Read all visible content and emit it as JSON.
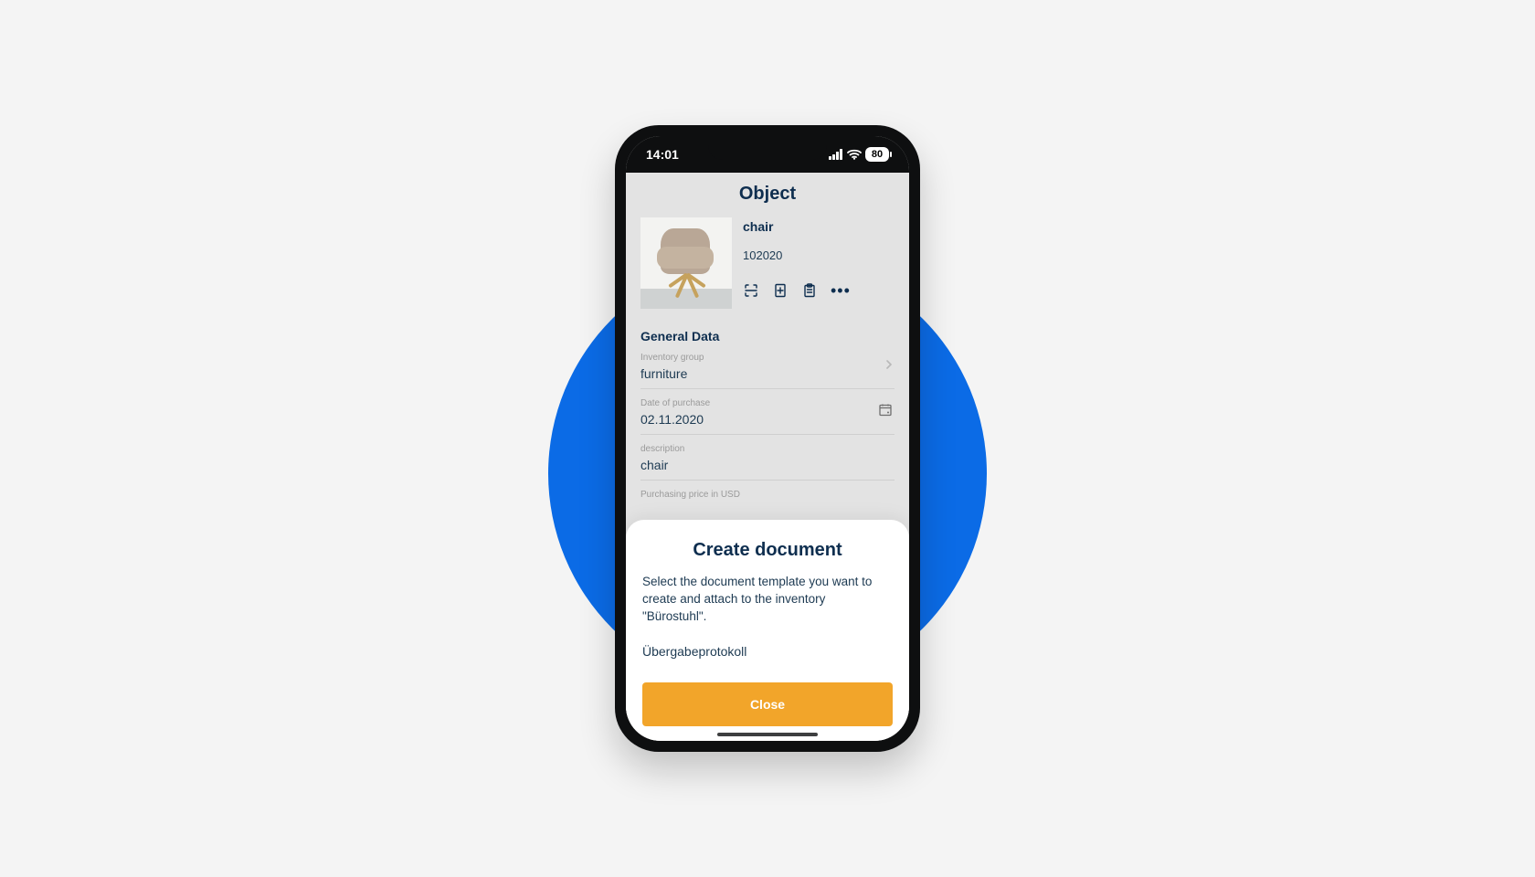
{
  "statusbar": {
    "time": "14:01",
    "battery": "80"
  },
  "page": {
    "title": "Object",
    "object_name": "chair",
    "object_code": "102020",
    "section_title": "General Data",
    "fields": {
      "inventory_group_label": "Inventory group",
      "inventory_group_value": "furniture",
      "purchase_date_label": "Date of purchase",
      "purchase_date_value": "02.11.2020",
      "description_label": "description",
      "description_value": "chair",
      "price_label": "Purchasing price in USD"
    }
  },
  "sheet": {
    "title": "Create document",
    "text": "Select the document template you want to create and attach to the inventory \"Bürostuhl\".",
    "template_option": "Übergabeprotokoll",
    "close_label": "Close"
  },
  "colors": {
    "accent_blue": "#0b6be6",
    "accent_orange": "#f2a52a",
    "text_dark": "#0e2e4f"
  }
}
